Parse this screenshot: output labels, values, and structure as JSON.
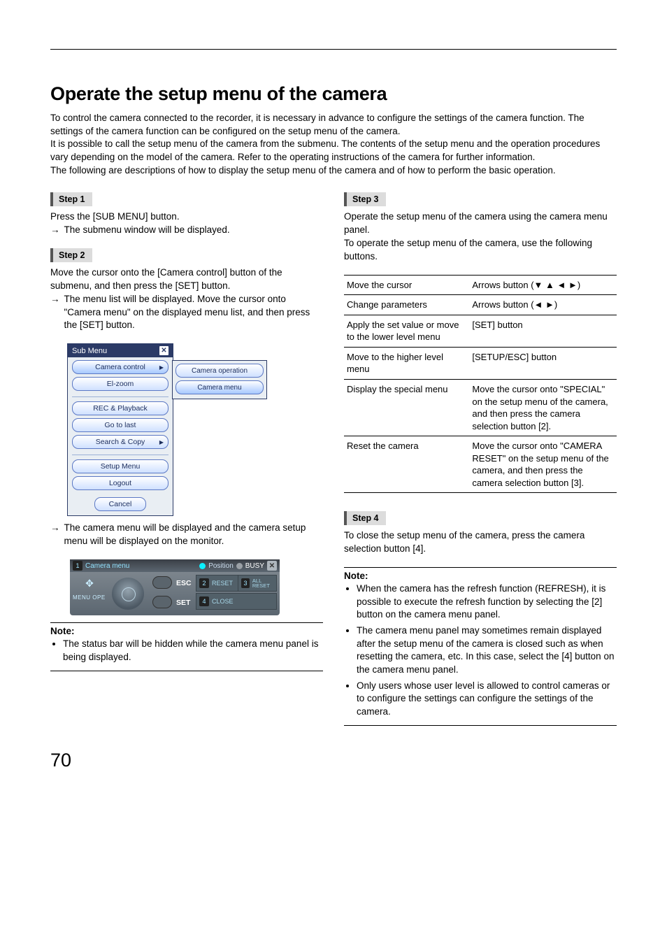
{
  "page_number": "70",
  "heading": "Operate the setup menu of the camera",
  "intro": "To control the camera connected to the recorder, it is necessary in advance to configure the settings of the camera function. The settings of the camera function can be configured on the setup menu of the camera.\nIt is possible to call the setup menu of the camera from the submenu. The contents of the setup menu and the operation procedures vary depending on the model of the camera. Refer to the operating instructions of the camera for further information.\nThe following are descriptions of how to display the setup menu of the camera and of how to perform the basic operation.",
  "steps": {
    "s1": {
      "label": "Step 1",
      "line1": "Press the [SUB MENU] button.",
      "arrow": "→",
      "line2": "The submenu window will be displayed."
    },
    "s2": {
      "label": "Step 2",
      "body": "Move the cursor onto the [Camera control] button of the submenu, and then press the [SET] button.",
      "arrow": "→",
      "body2": "The menu list will be displayed. Move the cursor onto \"Camera menu\" on the displayed menu list, and then press the [SET] button.",
      "arrow2": "→",
      "body3": "The camera menu will be displayed and the camera setup menu will be displayed on the monitor."
    },
    "s3": {
      "label": "Step 3",
      "body": "Operate the setup menu of the camera using the camera menu panel.",
      "body2": "To operate the setup menu of the camera, use the following buttons."
    },
    "s4": {
      "label": "Step 4",
      "body": "To close the setup menu of the camera, press the camera selection button [4]."
    }
  },
  "submenu": {
    "title": "Sub Menu",
    "items1": [
      "Camera control",
      "El-zoom"
    ],
    "items2": [
      "REC & Playback",
      "Go to last",
      "Search & Copy"
    ],
    "items3": [
      "Setup Menu",
      "Logout"
    ],
    "cancel": "Cancel",
    "flyout": [
      "Camera operation",
      "Camera menu"
    ]
  },
  "campanel": {
    "title": "Camera menu",
    "num1": "1",
    "position": "Position",
    "busy": "BUSY",
    "menuope": "MENU OPE",
    "esc": "ESC",
    "set": "SET",
    "c2n": "2",
    "c2t": "RESET",
    "c3n": "3",
    "c3t": "ALL RESET",
    "c4n": "4",
    "c4t": "CLOSE"
  },
  "note1": {
    "label": "Note:",
    "items": [
      "The status bar will be hidden while the camera menu panel is being displayed."
    ]
  },
  "table": {
    "rows": [
      {
        "a": "Move the cursor",
        "b": "Arrows button (▼ ▲ ◄ ►)"
      },
      {
        "a": "Change parameters",
        "b": "Arrows button (◄ ►)"
      },
      {
        "a": "Apply the set value or move to the lower level menu",
        "b": "[SET] button"
      },
      {
        "a": "Move to the higher level menu",
        "b": "[SETUP/ESC] button"
      },
      {
        "a": "Display the special menu",
        "b": "Move the cursor onto \"SPECIAL\" on the setup menu of the camera, and then press the camera selection button [2]."
      },
      {
        "a": "Reset the camera",
        "b": "Move the cursor onto \"CAMERA RESET\" on the setup menu of the camera, and then press the camera selection button [3]."
      }
    ]
  },
  "note2": {
    "label": "Note:",
    "items": [
      "When the camera has the refresh function (REFRESH), it is possible to execute the refresh function by selecting the [2] button on the camera menu panel.",
      "The camera menu panel may sometimes remain displayed after the setup menu of the camera is closed such as when resetting the camera, etc. In this case, select the [4] button on the camera menu panel.",
      "Only users whose user level is allowed to control cameras or to configure the settings can configure the settings of the camera."
    ]
  }
}
